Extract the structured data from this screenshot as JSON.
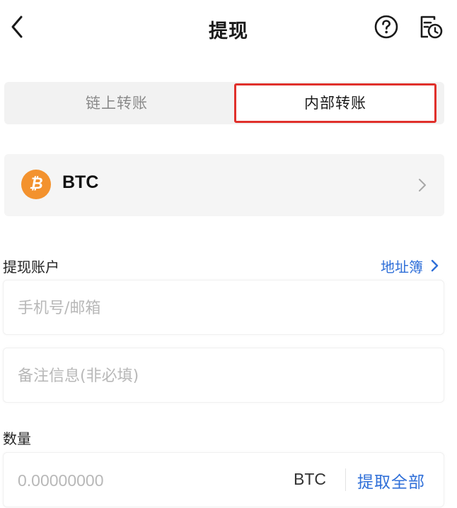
{
  "header": {
    "title": "提现",
    "back_icon": "chevron-left-icon",
    "help_icon": "question-circle-icon",
    "history_icon": "document-clock-icon"
  },
  "tabs": [
    {
      "label": "链上转账",
      "active": false
    },
    {
      "label": "内部转账",
      "active": true
    }
  ],
  "coin": {
    "symbol": "BTC",
    "icon": "bitcoin-icon",
    "icon_glyph": "₿",
    "icon_color": "#f3922e"
  },
  "account": {
    "label": "提现账户",
    "address_book": "地址簿",
    "phone_placeholder": "手机号/邮箱",
    "memo_placeholder": "备注信息(非必填)"
  },
  "quantity": {
    "label": "数量",
    "placeholder": "0.00000000",
    "unit": "BTC",
    "withdraw_all": "提取全部"
  },
  "colors": {
    "accent": "#2f6fd8",
    "highlight_border": "#e0302b",
    "btc_orange": "#f3922e"
  }
}
